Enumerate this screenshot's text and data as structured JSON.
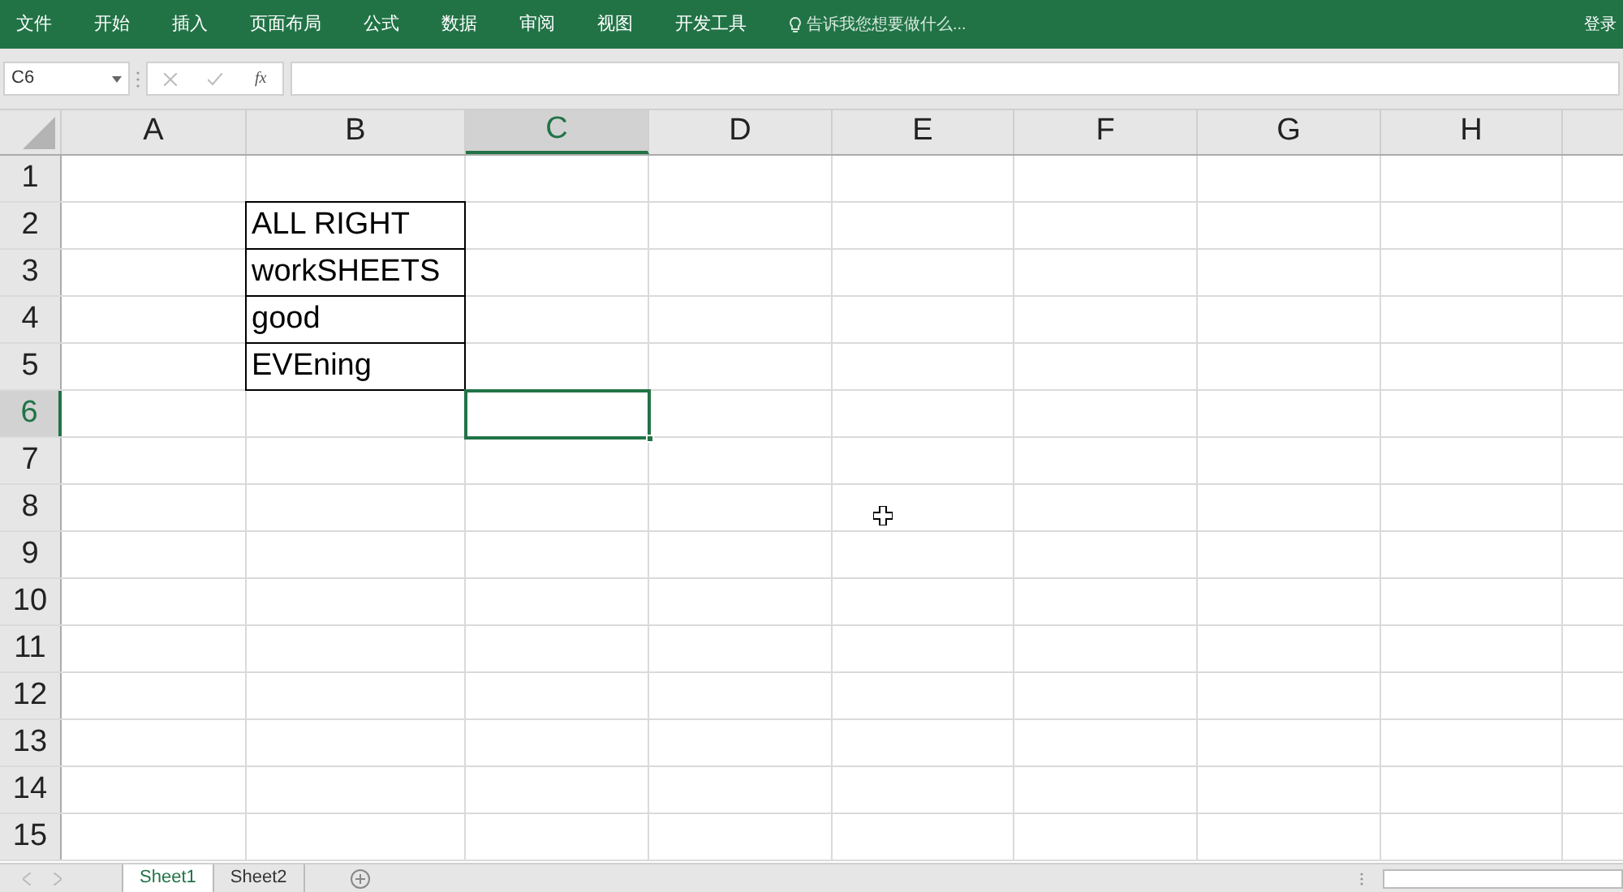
{
  "menu": [
    {
      "label": "文件"
    },
    {
      "label": "开始"
    },
    {
      "label": "插入"
    },
    {
      "label": "页面布局"
    },
    {
      "label": "公式"
    },
    {
      "label": "数据"
    },
    {
      "label": "审阅"
    },
    {
      "label": "视图"
    },
    {
      "label": "开发工具"
    }
  ],
  "tell_me": {
    "placeholder": "告诉我您想要做什么..."
  },
  "sign_in": "登录",
  "name_box": "C6",
  "formula_bar": {
    "fx": "fx"
  },
  "columns": [
    {
      "label": "A",
      "selected": false
    },
    {
      "label": "B",
      "selected": false
    },
    {
      "label": "C",
      "selected": true
    },
    {
      "label": "D",
      "selected": false
    },
    {
      "label": "E",
      "selected": false
    },
    {
      "label": "F",
      "selected": false
    },
    {
      "label": "G",
      "selected": false
    },
    {
      "label": "H",
      "selected": false
    }
  ],
  "rows": [
    {
      "header": "1",
      "selected": false
    },
    {
      "header": "2",
      "selected": false,
      "cells": [
        {},
        {
          "text": "ALL RIGHT",
          "bordered": true
        }
      ]
    },
    {
      "header": "3",
      "selected": false,
      "cells": [
        {},
        {
          "text": "workSHEETS",
          "bordered": true
        }
      ]
    },
    {
      "header": "4",
      "selected": false,
      "cells": [
        {},
        {
          "text": "good",
          "bordered": true
        }
      ]
    },
    {
      "header": "5",
      "selected": false,
      "cells": [
        {},
        {
          "text": "EVEning",
          "bordered": true
        }
      ]
    },
    {
      "header": "6",
      "selected": true,
      "cells": [
        {},
        {},
        {
          "selected": true
        }
      ]
    },
    {
      "header": "7",
      "selected": false
    },
    {
      "header": "8",
      "selected": false
    },
    {
      "header": "9",
      "selected": false
    },
    {
      "header": "10",
      "selected": false
    },
    {
      "header": "11",
      "selected": false
    },
    {
      "header": "12",
      "selected": false
    },
    {
      "header": "13",
      "selected": false
    },
    {
      "header": "14",
      "selected": false
    },
    {
      "header": "15",
      "selected": false
    }
  ],
  "sheet_tabs": [
    {
      "label": "Sheet1",
      "selected": true
    },
    {
      "label": "Sheet2",
      "selected": false
    }
  ]
}
